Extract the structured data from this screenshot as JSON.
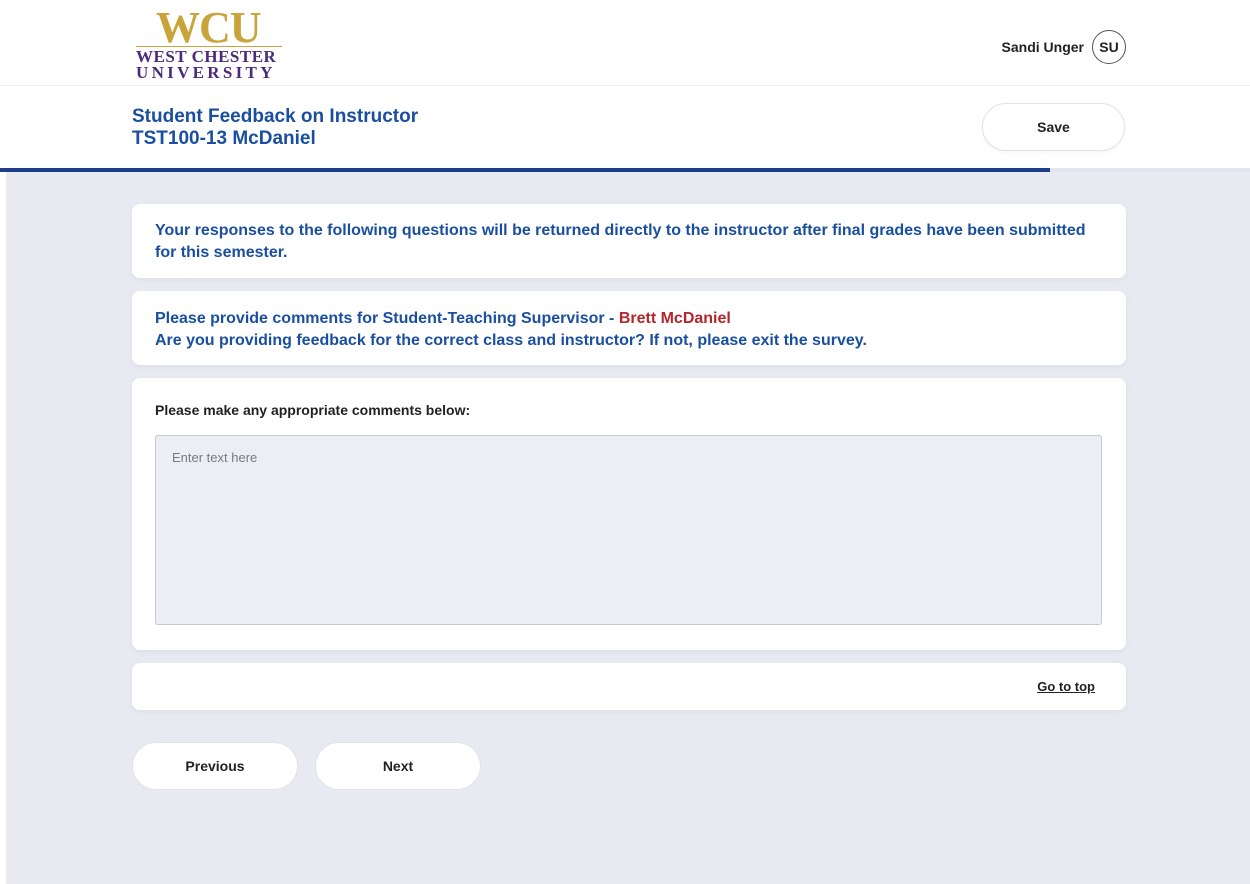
{
  "header": {
    "logo": {
      "mark": "WCU",
      "line1": "WEST CHESTER",
      "line2": "UNIVERSITY"
    },
    "user": {
      "name": "Sandi Unger",
      "initials": "SU"
    }
  },
  "titlebar": {
    "title": "Student Feedback on Instructor",
    "subtitle": "TST100-13 McDaniel",
    "save_label": "Save",
    "progress": 0.84
  },
  "main": {
    "notice": "Your responses to the following questions will be returned directly to the instructor after final grades have been submitted for this semester.",
    "instructor_prompt_prefix": "Please provide comments for Student-Teaching Supervisor - ",
    "instructor_name": "Brett McDaniel",
    "confirm_text": "Are you providing feedback for the correct class and instructor? If not, please exit the survey.",
    "question_label": "Please make any appropriate comments below:",
    "comment_placeholder": "Enter text here",
    "comment_value": "",
    "go_to_top": "Go to top",
    "previous_label": "Previous",
    "next_label": "Next"
  },
  "colors": {
    "primary_text": "#1a4fa0",
    "instructor_name": "#b3262c",
    "progress_bar": "#1c3f8c",
    "background": "#e9eaf1"
  }
}
